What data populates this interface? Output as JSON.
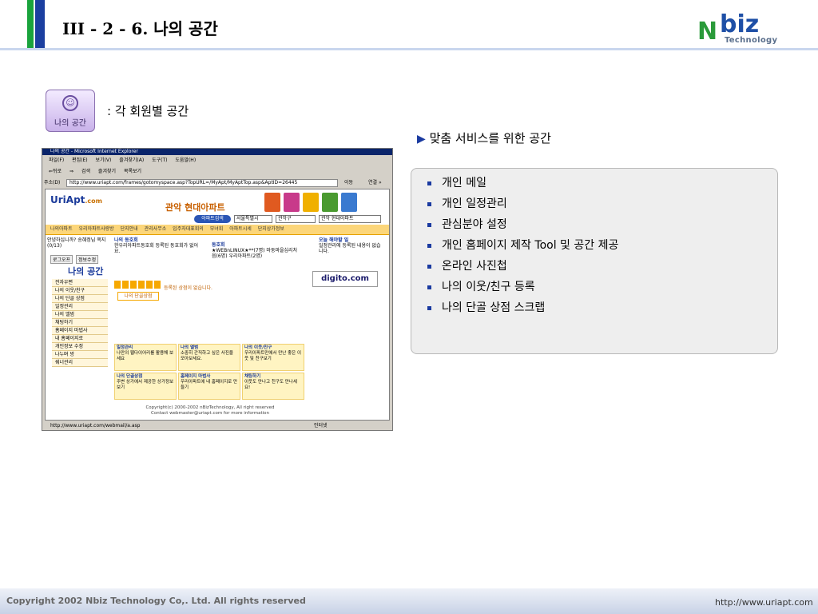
{
  "header": {
    "title": "III - 2 - 6. 나의 공간",
    "logo_n": "N",
    "logo_biz": "biz",
    "logo_tech": "Technology"
  },
  "badge": {
    "label": "나의 공간",
    "description": ": 각 회원별 공간"
  },
  "services": {
    "heading_marker": "▶",
    "heading": "맞춤 서비스를 위한 공간",
    "items": [
      "개인 메일",
      "개인 일정관리",
      "관심분야 설정",
      "개인 홈페이지 제작 Tool 및 공간 제공",
      "온라인 사진첩",
      "나의 이웃/친구 등록",
      "나의 단골 상점 스크랩"
    ]
  },
  "footer": {
    "copyright": "Copyright 2002 Nbiz Technology Co,. Ltd. All rights reserved",
    "url": "http://www.uriapt.com"
  },
  "browser": {
    "title": "나의 공간 - Microsoft Internet Explorer",
    "menu": [
      "파일(F)",
      "편집(E)",
      "보기(V)",
      "즐겨찾기(A)",
      "도구(T)",
      "도움말(H)"
    ],
    "toolbar": [
      "⇐뒤로",
      "⇒",
      "검색",
      "즐겨찾기",
      "목록보기"
    ],
    "address_label": "주소(D)",
    "address": "http://www.uriapt.com/frames/gotomyspace.asp?TopURL=/MyApt/MyAptTop.asp&AptID=26445",
    "go": "이동",
    "links": "연결 »",
    "status_url": "http://www.uriapt.com/webmail/a.asp",
    "status_zone": "인터넷",
    "site": {
      "logo": "UriApt",
      "logo_suffix": ".com",
      "brand": "관악 현대아파트",
      "search_btn": "아파트검색",
      "search_city": "서울특별시",
      "search_gu": "관악구",
      "search_apt": "관악 현대아파트",
      "nav": [
        "나의아파트",
        "우리아파트사랑방",
        "단지안내",
        "관리사무소",
        "입주자대표회의",
        "부녀회",
        "아파트시세",
        "단지상가정보"
      ],
      "greeting": "안녕하십니까? 송혜정님 쪽지(0/13)",
      "btn_logout": "로그오프",
      "btn_info": "정보수정",
      "side_title": "나의 공간",
      "side_menu": [
        "전자우편",
        "나의 이웃/친구",
        "나의 단골 상점",
        "일정관리",
        "나의 앨범",
        "채팅하기",
        "홈페이지 마법사",
        "내 홈페이지로",
        "개인정보 수정",
        "나누며 방",
        "쉐너관리"
      ],
      "community_title": "나의 동호회",
      "community_body": "한우리아파트동호회 등록된 동호회가 없어요.",
      "club_title": "동호회",
      "club_body": "★WEBnLINUX★**(7명) 마둥마을십리처음(6명) 우리아파트(2명)",
      "today_title": "오늘 해야할 일",
      "today_body": "일정관리에 등록된 내용이 없습니다.",
      "digito": "digito.com",
      "shop_tag": "나의 단골상점",
      "shop_msg": "등록된 상점이 없습니다.",
      "grid": [
        {
          "title": "일정관리",
          "body": "나만의 웹다이어리를 활용해 보세요"
        },
        {
          "title": "나의 앨범",
          "body": "소중히 간직하고 싶은 사진을 모아보세요."
        },
        {
          "title": "나의 이웃/친구",
          "body": "우리아파트만에서 만난 좋은 이웃 및 친구보기"
        },
        {
          "title": "나의 단골상점",
          "body": "주변 상가에서 제공한 상가정보 보기"
        },
        {
          "title": "홈페이지 마법사",
          "body": "우리아파트에 내 홈페이지로 만들기"
        },
        {
          "title": "채팅하기",
          "body": "이웃도 만나고 친구도 만나세요!"
        }
      ],
      "copyright1": "Copyright(c) 2000-2002 nBizTechnology, All right reserved",
      "copyright2": "Contact webmaster@uriapt.com for more information"
    }
  }
}
